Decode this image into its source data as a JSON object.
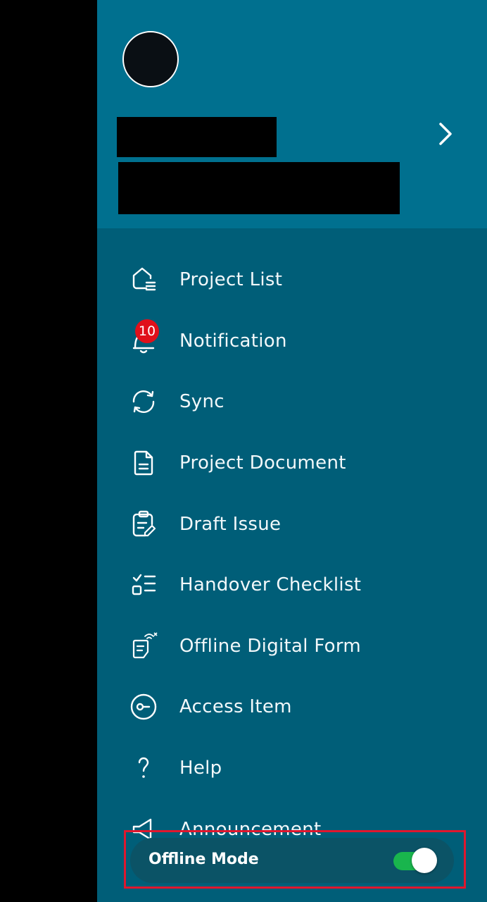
{
  "profile": {
    "avatar_icon": "avatar",
    "chevron_icon": "chevron-right-icon"
  },
  "menu": {
    "items": [
      {
        "label": "Project List",
        "icon": "home-list-icon"
      },
      {
        "label": "Notification",
        "icon": "bell-icon",
        "badge": "10"
      },
      {
        "label": "Sync",
        "icon": "sync-icon"
      },
      {
        "label": "Project Document",
        "icon": "document-icon"
      },
      {
        "label": "Draft Issue",
        "icon": "clipboard-edit-icon"
      },
      {
        "label": "Handover Checklist",
        "icon": "checklist-icon"
      },
      {
        "label": "Offline Digital Form",
        "icon": "offline-form-icon"
      },
      {
        "label": "Access Item",
        "icon": "key-circle-icon"
      },
      {
        "label": "Help",
        "icon": "question-icon"
      },
      {
        "label": "Announcement",
        "icon": "megaphone-icon"
      }
    ]
  },
  "offline_mode": {
    "label": "Offline Mode",
    "enabled": true
  },
  "colors": {
    "drawer_bg": "#005e78",
    "profile_bg": "#00708f",
    "toggle_on": "#19b54d",
    "badge": "#e0101a",
    "highlight_border": "#e0172e"
  }
}
